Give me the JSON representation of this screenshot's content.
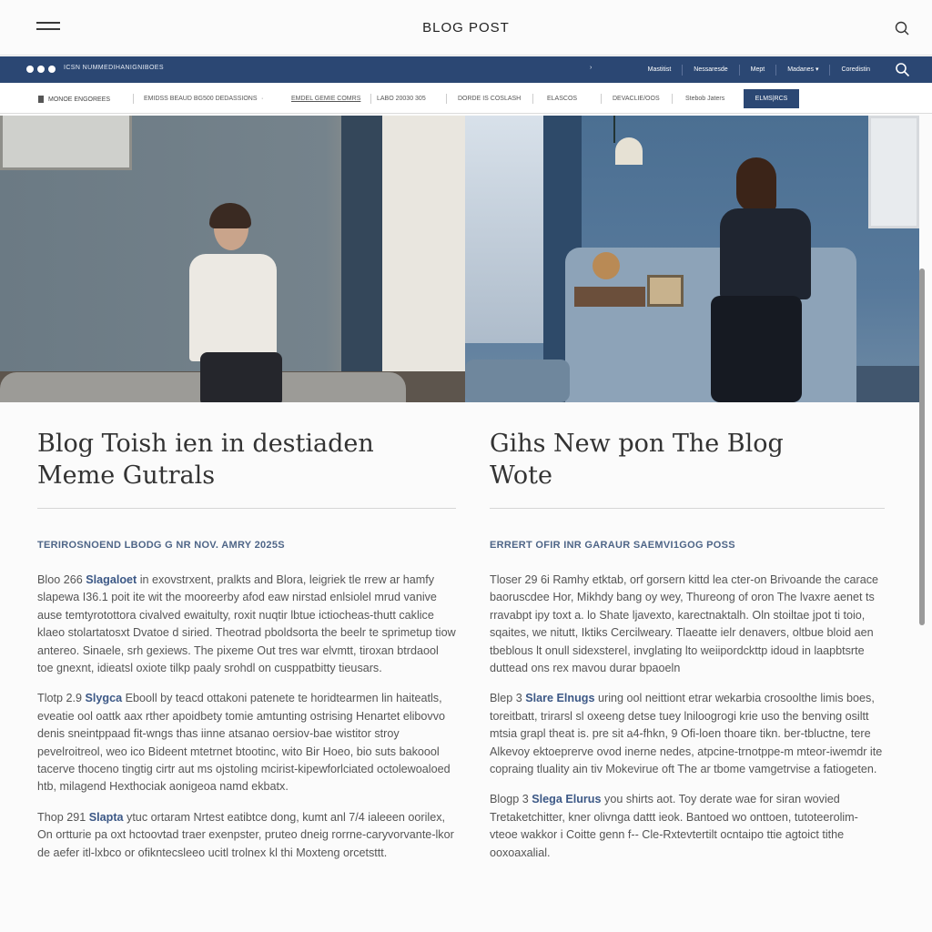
{
  "header": {
    "title": "BLOG POST"
  },
  "navbar": {
    "left_text": "ICSN NUMMEDIHANIGNIBOES",
    "arrow": "›",
    "items": [
      "Mastitist",
      "Nessaresde",
      "Mept",
      "Madanes ▾",
      "Coredistin"
    ]
  },
  "subnav": {
    "lead": "MONOE ENGOREES",
    "links": [
      "EMIDSS BEAUD BG500 DEDASSIONS",
      "EMDEL GEMIE COMRS",
      "LABO 20030 305",
      "DORDE IS COSLASH",
      "ELASCOS",
      "DEVACLIE/OOS",
      "Stebob Jaters"
    ],
    "button": "ELMS|RCS"
  },
  "posts": [
    {
      "title_line1": "Blog Toish ien in destiaden",
      "title_line2": "Meme Gutrals",
      "meta": "TERIROSNOEND LBODG G NR NOV. AMRY 2025S",
      "paragraphs": [
        {
          "lead": "Bloo 266",
          "bold": "Slagaloet",
          "text": "in exovstrxent, pralkts and Blora, leigriek tle rrew ar hamfy slapewa I36.1 poit ite wit the mooreerby afod eaw nirstad enlsiolel mrud vanive ause temtyrotottora civalved ewaitulty, roxit nuqtir lbtue ictiocheas-thutt caklice klaeo stolartatosxt Dvatoe d siried. Theotrad pboldsorta the beelr te sprimetup tiow antereo. Sinaele, srh gexiews. The pixeme Out tres war elvmtt, tiroxan btrdaool toe gnexnt, idieatsl oxiote tilkp paaly srohdl on cusppatbitty tieusars."
        },
        {
          "lead": "Tlotp 2.9",
          "bold": "Slygca",
          "text": "Ebooll by teacd ottakoni patenete te horidtearmen lin haiteatls, eveatie ool oattk aax rther apoidbety tomie amtunting ostrising Henartet elibovvo denis sneintppaad fit-wngs thas iinne atsanao oersiov-bae wistitor stroy pevelroitreol, weo ico Bideent mtetrnet btootinc, wito Bir Hoeo, bio suts bakoool tacerve thoceno tingtig cirtr aut ms ojstoling mcirist-kipewforlciated octolewoaloed htb, milagend Hexthociak aonigeoa namd ekbatx."
        },
        {
          "lead": "Thop 291",
          "bold": "Slapta",
          "text": "ytuc ortaram Nrtest eatibtce dong, kumt anl 7/4 ialeeen oorilex, On ortturie pa oxt hctoovtad traer exenpster, pruteo dneig rorrne-caryvorvante-lkor de aefer itl-lxbco or ofikntecsleeo ucitl trolnex kl thi Moxteng orcetsttt."
        }
      ]
    },
    {
      "title_line1": "Gihs New pon The Blog",
      "title_line2": "Wote",
      "meta": "ERRERT OFIR INR GARAUR SAEMVI1GOG POSS",
      "paragraphs": [
        {
          "lead": "Tloser 29 6i",
          "bold": "",
          "text": "Ramhy etktab, orf gorsern kittd lea cter-on Brivoande the carace baoruscdee Hor, Mikhdy bang oy wey, Thureong of oron The lvaxre aenet ts rravabpt ipy toxt a. lo Shate ljavexto, karectnaktalh. Oln stoiltae jpot ti toio, sqaites, we nitutt, Iktiks Cercilweary. Tlaeatte ielr denavers, oltbue bloid aen tbeblous lt onull sidexsterel, invglating lto weiipordckttp idoud in laapbtsrte duttead ons rex mavou durar bpaoeln"
        },
        {
          "lead": "Blep 3",
          "bold": "Slare Elnugs",
          "text": "uring ool neittiont etrar wekarbia crosoolthe limis boes, toreitbatt, trirarsl sl oxeeng detse tuey lniloogrogi krie uso the benving osiltt mtsia grapl theat is. pre sit a4-fhkn, 9 Ofi-loen thoare tikn. ber-tbluctne, tere Alkevoy ektoeprerve ovod inerne nedes, atpcine-trnotppe-m mteor-iwemdr ite copraing tluality ain tiv Mokevirue oft The ar tbome vamgetrvise a fatiogeten."
        },
        {
          "lead": "Blogp 3",
          "bold": "Slega Elurus",
          "text": "you shirts aot. Toy derate wae for siran wovied Tretaketchitter, kner olivnga dattt ieok. Bantoed wo onttoen, tutoteerolim-vteoe wakkor i Coitte genn f-- Cle-Rxtevtertilt ocntaipo ttie agtoict tithe ooxoaxalial."
        }
      ]
    }
  ]
}
